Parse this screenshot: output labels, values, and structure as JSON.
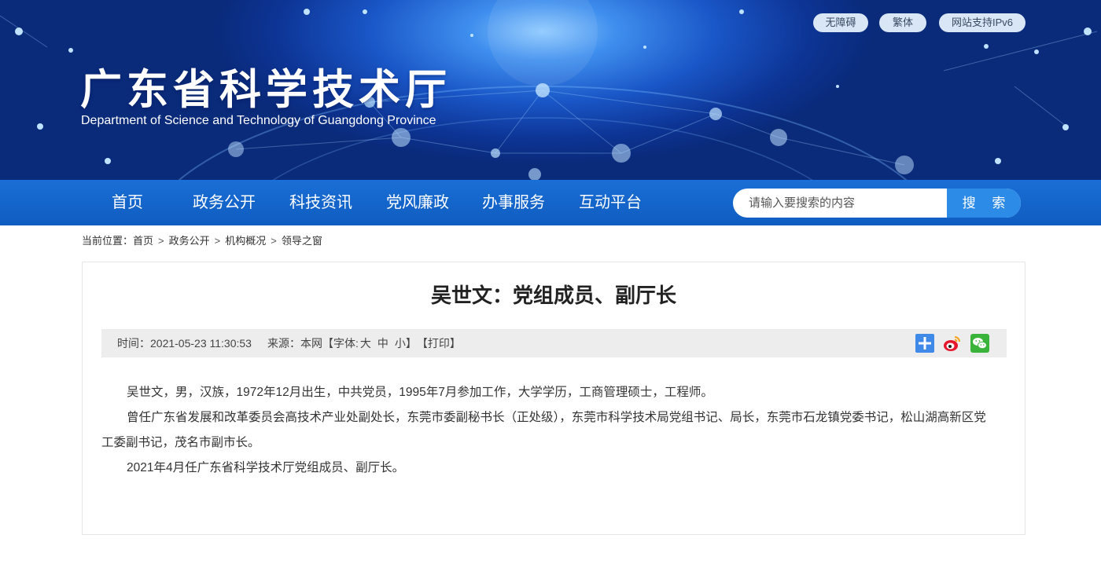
{
  "header": {
    "title": "广东省科学技术厅",
    "subtitle": "Department of Science and Technology of Guangdong Province",
    "top_links": [
      "无障碍",
      "繁体",
      "网站支持IPv6"
    ]
  },
  "nav": {
    "items": [
      "首页",
      "政务公开",
      "科技资讯",
      "党风廉政",
      "办事服务",
      "互动平台"
    ]
  },
  "search": {
    "placeholder": "请输入要搜索的内容",
    "button": "搜 索"
  },
  "breadcrumb": {
    "label": "当前位置：",
    "items": [
      "首页",
      "政务公开",
      "机构概况",
      "领导之窗"
    ],
    "separator": ">"
  },
  "article": {
    "title": "吴世文：党组成员、副厅长",
    "meta": {
      "time": "时间：2021-05-23 11:30:53",
      "source": "来源：本网",
      "font_label": "【字体:",
      "font_options": [
        "大",
        "中",
        "小"
      ],
      "font_close": "】",
      "print": "【打印】"
    },
    "share_icons": [
      "share-plus-icon",
      "weibo-icon",
      "wechat-icon"
    ],
    "paragraphs": [
      "吴世文，男，汉族，1972年12月出生，中共党员，1995年7月参加工作，大学学历，工商管理硕士，工程师。",
      "曾任广东省发展和改革委员会高技术产业处副处长，东莞市委副秘书长（正处级），东莞市科学技术局党组书记、局长，东莞市石龙镇党委书记，松山湖高新区党工委副书记，茂名市副市长。",
      "2021年4月任广东省科学技术厅党组成员、副厅长。"
    ]
  },
  "colors": {
    "nav_bg": "#0f5cc0",
    "search_button": "#2d8be8",
    "meta_bar": "#ededed",
    "share_plus": "#3f8ae8",
    "weibo": "#e6162d",
    "wechat": "#3ab33a"
  }
}
